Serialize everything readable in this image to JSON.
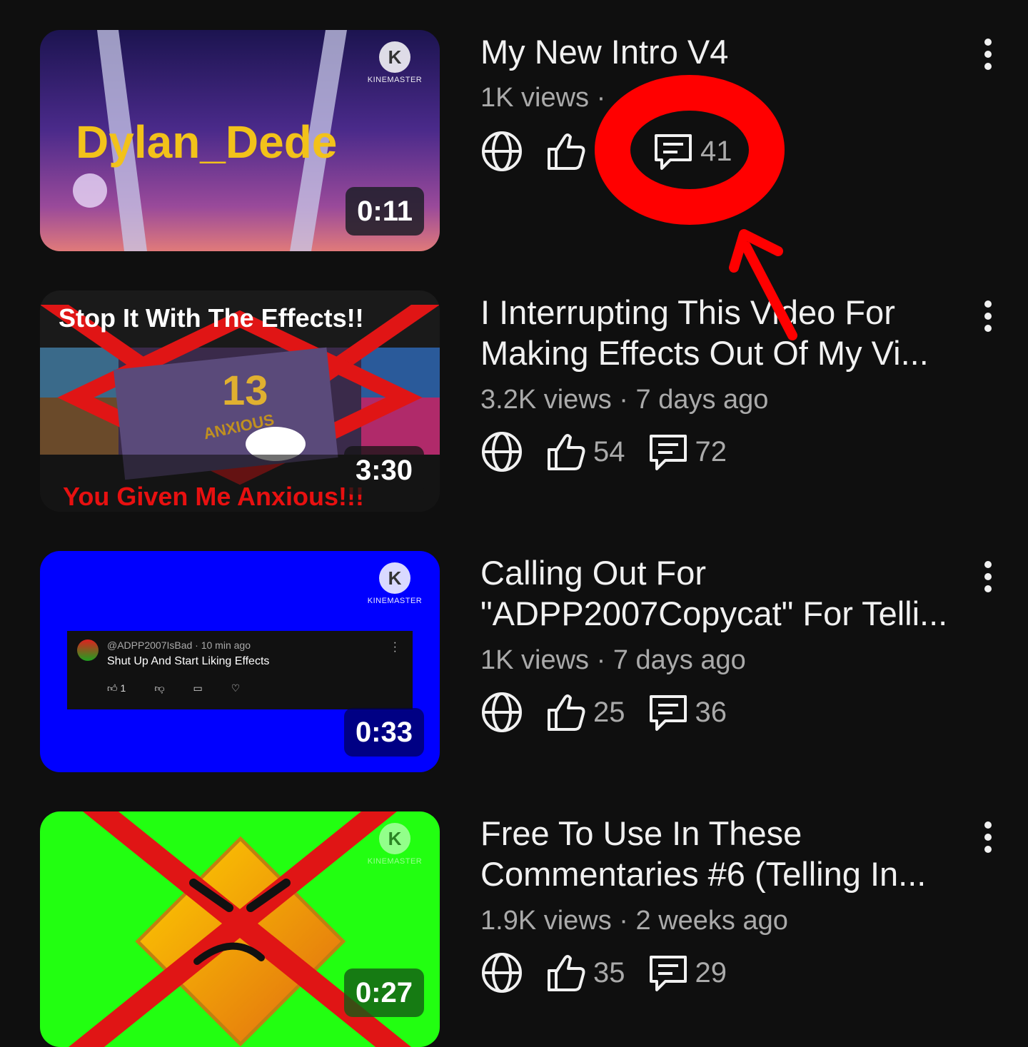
{
  "videos": [
    {
      "title": "My New Intro V4",
      "meta": "1K views ·",
      "likes": "",
      "comments": "41",
      "duration": "0:11",
      "thumb_text": "Dylan_Dede",
      "logo_text": "KINEMASTER"
    },
    {
      "title": "I Interrupting This Video For Making Effects Out Of My Vi...",
      "meta": "3.2K views · 7 days ago",
      "likes": "54",
      "comments": "72",
      "duration": "3:30",
      "thumb_top": "Stop It With The Effects!!",
      "thumb_bottom": "You Given Me Anxious!!!",
      "thumb_logo": "13",
      "thumb_sub": "ANXIOUS"
    },
    {
      "title": "Calling Out For \"ADPP2007Copycat\" For Telli...",
      "meta": "1K views · 7 days ago",
      "likes": "25",
      "comments": "36",
      "duration": "0:33",
      "logo_text": "KINEMASTER",
      "comment_card": {
        "handle": "@ADPP2007IsBad · 10 min ago",
        "text": "Shut Up And Start Liking Effects",
        "likes": "1"
      }
    },
    {
      "title": "Free To Use In These Commentaries #6 (Telling In...",
      "meta": "1.9K views · 2 weeks ago",
      "likes": "35",
      "comments": "29",
      "duration": "0:27",
      "logo_text": "KINEMASTER"
    }
  ],
  "icons": {
    "visibility": "globe-icon",
    "like": "thumbs-up-icon",
    "comment": "comment-icon",
    "more": "more-vertical-icon"
  },
  "colors": {
    "background": "#0f0f0f",
    "annotation": "#ff0000",
    "thumb3_bg": "#0000ff",
    "thumb4_bg": "#22ff11"
  }
}
